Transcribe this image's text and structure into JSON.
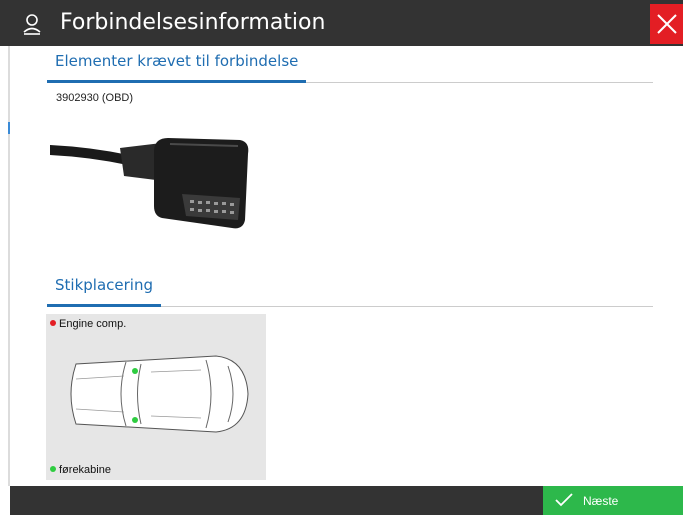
{
  "window": {
    "title": "Forbindelsesinformation",
    "icon": "person-icon",
    "close_icon": "close-icon",
    "accent": "#e31e24"
  },
  "section_required": {
    "heading": "Elementer krævet til forbindelse",
    "part_label": "3902930 (OBD)",
    "image": "obd-connector-image"
  },
  "section_location": {
    "heading": "Stikplacering",
    "legend": [
      {
        "label": "Engine comp.",
        "color": "#e31e24"
      },
      {
        "label": "førekabine",
        "color": "#2ecc40"
      }
    ]
  },
  "footer": {
    "next_label": "Næste",
    "next_icon": "checkmark-icon",
    "next_color": "#2db84b"
  },
  "colors": {
    "titlebar": "#333333",
    "tab_accent": "#1f6db1"
  }
}
